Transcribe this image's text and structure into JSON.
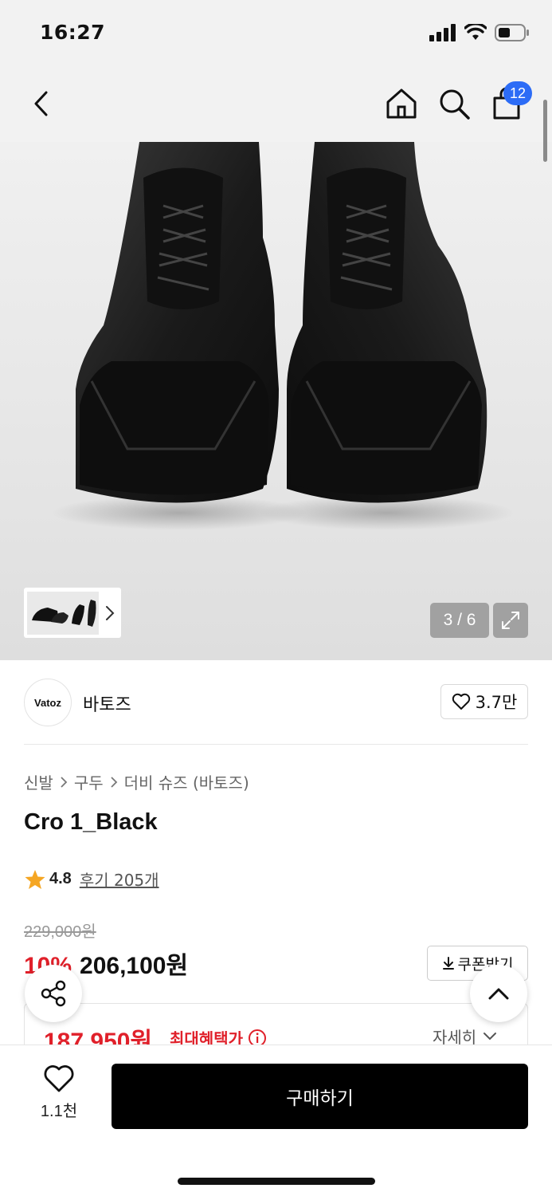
{
  "status_bar": {
    "time": "16:27"
  },
  "nav": {
    "cart_count": "12"
  },
  "gallery": {
    "counter": "3 / 6"
  },
  "brand": {
    "logo_text": "Vatoz",
    "name": "바토즈",
    "likes": "3.7만"
  },
  "breadcrumb": {
    "items": [
      "신발",
      "구두",
      "더비 슈즈 (바토즈)"
    ]
  },
  "product": {
    "title": "Cro 1_Black",
    "rating": "4.8",
    "review_text": "후기 205개",
    "original_price": "229,000원",
    "discount": "10%",
    "sale_price": "206,100원",
    "coupon_label": "쿠폰받기"
  },
  "benefit": {
    "price": "187,950원",
    "label": "최대혜택가",
    "detail_label": "자세히"
  },
  "bottom_bar": {
    "wish_count": "1.1천",
    "buy_label": "구매하기"
  },
  "colors": {
    "accent_red": "#e0202a",
    "badge_blue": "#2c6cf6",
    "buy_black": "#000000",
    "star": "#f5a623"
  }
}
